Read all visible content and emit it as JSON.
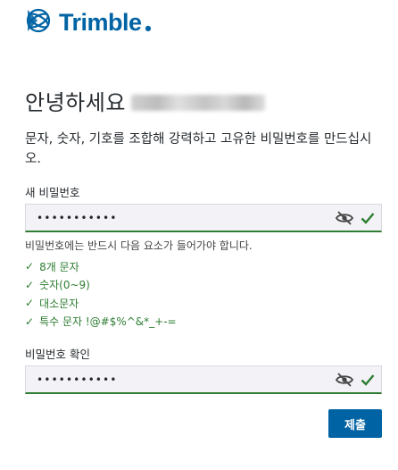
{
  "brand": {
    "name": "Trimble",
    "color": "#0063a3",
    "icon": "trimble-globe-icon"
  },
  "greeting": {
    "text": "안녕하세요"
  },
  "instruction": "문자, 숫자, 기호를 조합해 강력하고 고유한 비밀번호를 만드십시오.",
  "new_password": {
    "label": "새 비밀번호",
    "value": "•••••••••••",
    "icons": [
      "eye-slash-icon",
      "checkmark-icon"
    ]
  },
  "requirements": {
    "title": "비밀번호에는 반드시 다음 요소가 들어가야 합니다.",
    "items": [
      {
        "label": "8개 문자",
        "met": true
      },
      {
        "label": "숫자(0~9)",
        "met": true
      },
      {
        "label": "대소문자",
        "met": true
      },
      {
        "label": "특수 문자 !@#$%^&*_+-=",
        "met": true
      }
    ]
  },
  "confirm_password": {
    "label": "비밀번호 확인",
    "value": "•••••••••••",
    "icons": [
      "eye-slash-icon",
      "checkmark-icon"
    ]
  },
  "submit": {
    "label": "제출"
  },
  "colors": {
    "accent": "#0063a3",
    "success": "#2e7d32",
    "text": "#252a2e"
  }
}
